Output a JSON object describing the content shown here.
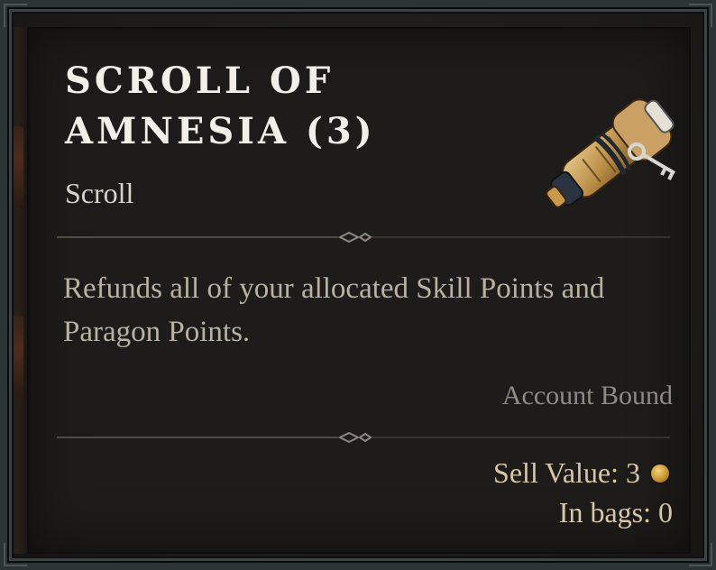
{
  "item": {
    "name": "SCROLL OF AMNESIA (3)",
    "type": "Scroll",
    "description": "Refunds all of your allocated Skill Points and Paragon Points.",
    "binding": "Account Bound",
    "sell_value_label": "Sell Value: 3",
    "in_bags_label": "In bags: 0",
    "icon": "scroll-with-key-icon"
  },
  "colors": {
    "title": "#f2efe9",
    "subtitle": "#d9d5cd",
    "description": "#b9b1a2",
    "binding": "#8f8a84",
    "value_text": "#d8c7a6",
    "gold": "#c9962f"
  }
}
